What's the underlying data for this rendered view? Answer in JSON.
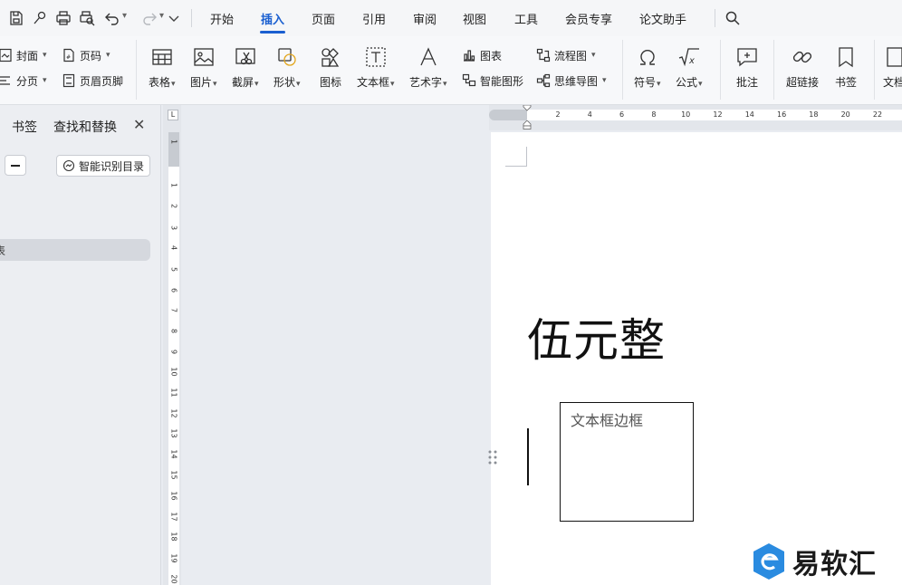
{
  "menubar": {
    "tabs": [
      {
        "label": "开始"
      },
      {
        "label": "插入",
        "active": true
      },
      {
        "label": "页面"
      },
      {
        "label": "引用"
      },
      {
        "label": "审阅"
      },
      {
        "label": "视图"
      },
      {
        "label": "工具"
      },
      {
        "label": "会员专享"
      },
      {
        "label": "论文助手"
      }
    ],
    "quick_access_icons": [
      "save-icon",
      "format-painter-icon",
      "print-icon",
      "print-preview-icon",
      "undo-icon",
      "redo-icon",
      "more-chevron-icon"
    ],
    "search_icon": "search-icon"
  },
  "ribbon": {
    "cover": "封面",
    "page_number": "页码",
    "page_break": "分页",
    "header_footer": "页眉页脚",
    "table": "表格",
    "picture": "图片",
    "screenshot": "截屏",
    "shape": "形状",
    "icon": "图标",
    "textbox": "文本框",
    "wordart": "艺术字",
    "chart": "图表",
    "smart_graphic": "智能图形",
    "flowchart": "流程图",
    "mindmap": "思维导图",
    "symbol": "符号",
    "formula": "公式",
    "comment": "批注",
    "hyperlink": "超链接",
    "bookmark": "书签",
    "doc_part": "文档"
  },
  "navpane": {
    "tab_bookmark": "书签",
    "tab_find_replace": "查找和替换",
    "close": "✕",
    "smart_toc": "智能识别目录",
    "toc_item": "表"
  },
  "vruler": {
    "corner": "L",
    "ticks": [
      "1",
      "1",
      "2",
      "3",
      "4",
      "5",
      "6",
      "7",
      "8",
      "9",
      "10",
      "11",
      "12",
      "13",
      "14",
      "15",
      "16",
      "17",
      "18",
      "19",
      "20"
    ]
  },
  "hruler": {
    "ticks": [
      "2",
      "4",
      "6",
      "8",
      "10",
      "12",
      "14",
      "16",
      "18",
      "20",
      "22"
    ]
  },
  "document": {
    "heading": "伍元整",
    "textbox_text": "文本框边框"
  },
  "watermark": {
    "text": "易软汇"
  },
  "colors": {
    "accent": "#1a5fd0",
    "menubar_bg": "#f5f6f8",
    "ribbon_bg": "#f7f8fa",
    "workspace_bg": "#e9ecf1",
    "logo_blue": "#2a8be0"
  }
}
